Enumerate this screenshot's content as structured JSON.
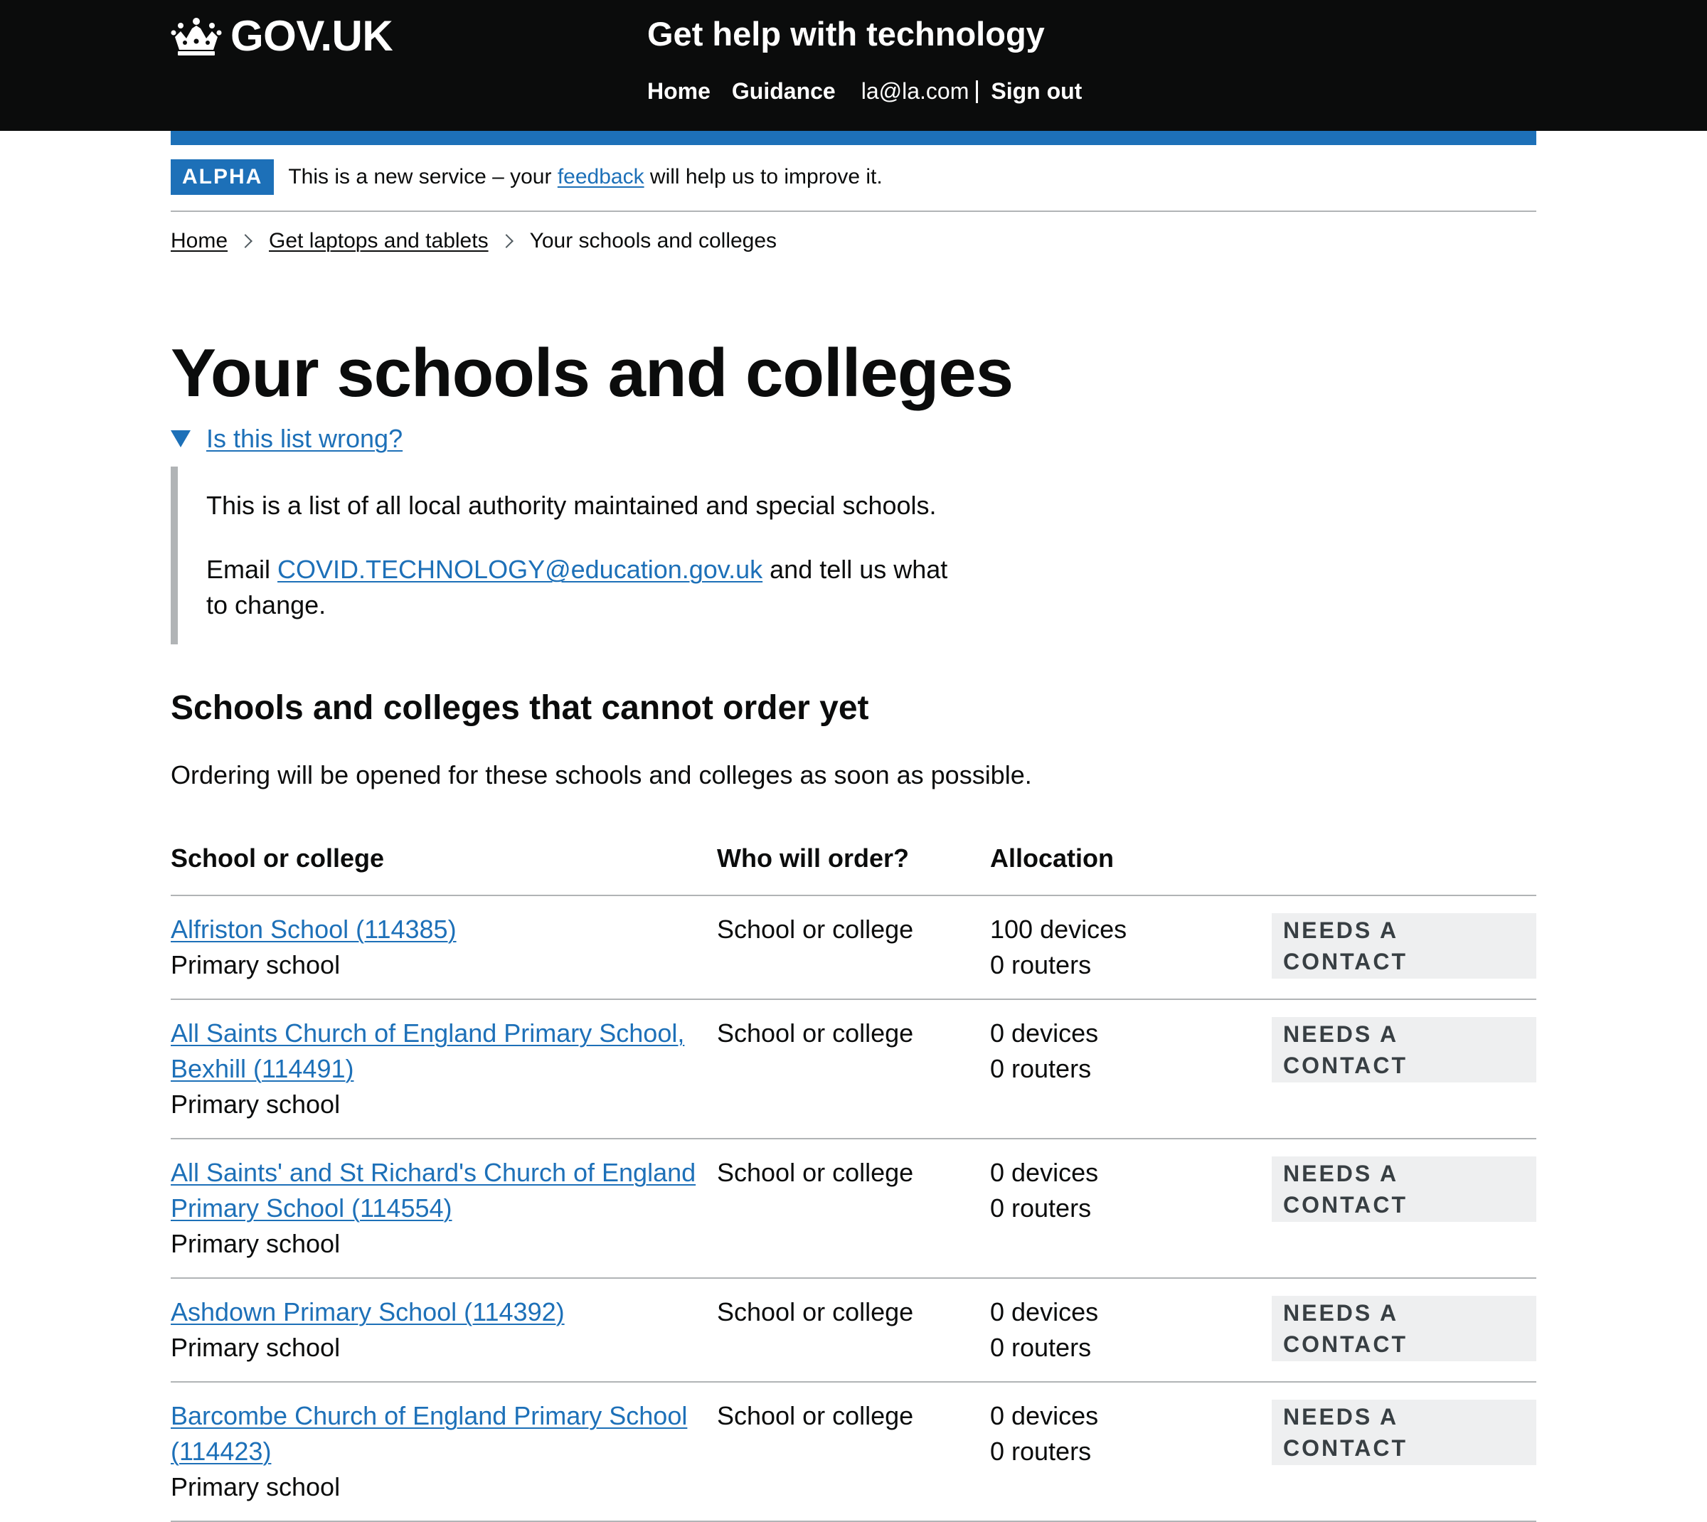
{
  "header": {
    "logo_text": "GOV.UK",
    "service_name": "Get help with technology",
    "nav": {
      "home": "Home",
      "guidance": "Guidance",
      "user_email": "la@la.com",
      "sign_out": "Sign out"
    }
  },
  "phase_banner": {
    "tag": "ALPHA",
    "text_before": "This is a new service – your ",
    "link": "feedback",
    "text_after": " will help us to improve it."
  },
  "breadcrumbs": [
    "Home",
    "Get laptops and tablets",
    "Your schools and colleges"
  ],
  "page_title": "Your schools and colleges",
  "details": {
    "summary": "Is this list wrong?",
    "paragraph1": "This is a list of all local authority maintained and special schools.",
    "email_prefix": "Email ",
    "email_link": "COVID.TECHNOLOGY@education.gov.uk",
    "email_suffix": " and tell us what to change."
  },
  "section": {
    "heading": "Schools and colleges that cannot order yet",
    "lead": "Ordering will be opened for these schools and colleges as soon as possible."
  },
  "table": {
    "headers": [
      "School or college",
      "Who will order?",
      "Allocation",
      ""
    ],
    "rows": [
      {
        "name": "Alfriston School (114385)",
        "type": "Primary school",
        "orderer": "School or college",
        "devices": "100 devices",
        "routers": "0 routers",
        "status": "NEEDS A CONTACT"
      },
      {
        "name": "All Saints Church of England Primary School, Bexhill (114491)",
        "type": "Primary school",
        "orderer": "School or college",
        "devices": "0 devices",
        "routers": "0 routers",
        "status": "NEEDS A CONTACT"
      },
      {
        "name": "All Saints' and St Richard's Church of England Primary School (114554)",
        "type": "Primary school",
        "orderer": "School or college",
        "devices": "0 devices",
        "routers": "0 routers",
        "status": "NEEDS A CONTACT"
      },
      {
        "name": "Ashdown Primary School (114392)",
        "type": "Primary school",
        "orderer": "School or college",
        "devices": "0 devices",
        "routers": "0 routers",
        "status": "NEEDS A CONTACT"
      },
      {
        "name": "Barcombe Church of England Primary School (114423)",
        "type": "Primary school",
        "orderer": "School or college",
        "devices": "0 devices",
        "routers": "0 routers",
        "status": "NEEDS A CONTACT"
      }
    ]
  },
  "colors": {
    "header_bg": "#0b0c0c",
    "brand_blue": "#1d70b8",
    "link": "#1d70b8",
    "border": "#b1b4b6",
    "tag_grey_bg": "#eeeff0"
  }
}
